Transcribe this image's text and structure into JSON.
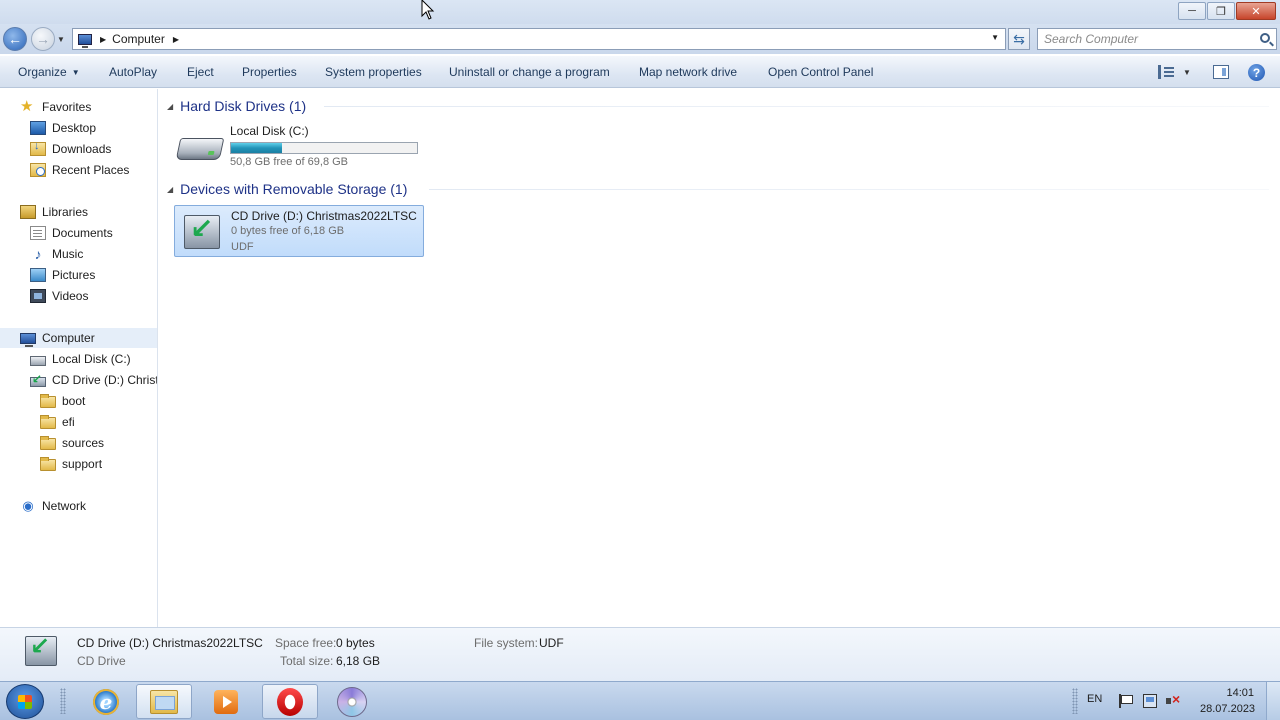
{
  "window": {
    "buttons": {
      "minimize": "─",
      "restore": "❐",
      "close": "✕"
    }
  },
  "address": {
    "path": "Computer",
    "search_placeholder": "Search Computer"
  },
  "commands": {
    "organize": "Organize",
    "autoplay": "AutoPlay",
    "eject": "Eject",
    "properties": "Properties",
    "system_properties": "System properties",
    "uninstall": "Uninstall or change a program",
    "map_drive": "Map network drive",
    "control_panel": "Open Control Panel",
    "help": "?"
  },
  "nav": {
    "favorites": "Favorites",
    "desktop": "Desktop",
    "downloads": "Downloads",
    "recent": "Recent Places",
    "libraries": "Libraries",
    "documents": "Documents",
    "music": "Music",
    "pictures": "Pictures",
    "videos": "Videos",
    "computer": "Computer",
    "local_disk": "Local Disk (C:)",
    "cd_drive": "CD Drive (D:) Christr",
    "folders": [
      "boot",
      "efi",
      "sources",
      "support"
    ],
    "network": "Network"
  },
  "groups": {
    "hdd": {
      "title": "Hard Disk Drives (1)",
      "name": "Local Disk (C:)",
      "free": "50,8 GB free of 69,8 GB",
      "used_fraction": 0.272
    },
    "removable": {
      "title": "Devices with Removable Storage (1)",
      "name": "CD Drive (D:) Christmas2022LTSC",
      "free": "0 bytes free of 6,18 GB",
      "fs": "UDF"
    }
  },
  "details": {
    "title": "CD Drive (D:) Christmas2022LTSC",
    "type": "CD Drive",
    "space_free_label": "Space free:",
    "space_free": "0 bytes",
    "total_size_label": "Total size:",
    "total_size": "6,18 GB",
    "fs_label": "File system:",
    "fs": "UDF"
  },
  "taskbar": {
    "lang": "EN",
    "time": "14:01",
    "date": "28.07.2023",
    "ie_letter": "e"
  },
  "colors": {
    "accent": "#1e3287",
    "capacity": "#2394b8",
    "selection": "#c1dcfb"
  }
}
